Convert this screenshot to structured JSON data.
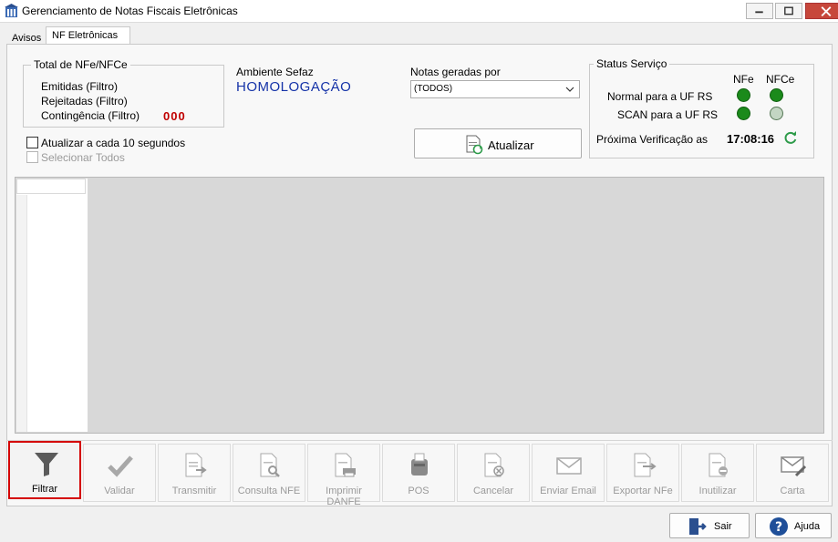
{
  "window": {
    "title": "Gerenciamento de Notas Fiscais Eletrônicas",
    "icon": "building-icon",
    "controls": [
      "minimize-icon",
      "maximize-icon",
      "close-icon"
    ]
  },
  "tabs": [
    {
      "label": "Avisos",
      "active": false
    },
    {
      "label": "NF Eletrônicas",
      "active": true
    }
  ],
  "totals": {
    "title": "Total de NFe/NFCe",
    "emitidas": "Emitidas (Filtro)",
    "rejeitadas": "Rejeitadas (Filtro)",
    "contingencia": "Contingência (Filtro)",
    "contingencia_value": "000"
  },
  "ambiente": {
    "label": "Ambiente Sefaz",
    "value": "HOMOLOGAÇÃO"
  },
  "notas": {
    "label": "Notas geradas por",
    "selected": "(TODOS)"
  },
  "options": {
    "auto_refresh": "Atualizar a cada 10 segundos",
    "select_all": "Selecionar Todos"
  },
  "atualizar_button": "Atualizar",
  "status": {
    "title": "Status Serviço",
    "col_nfe": "NFe",
    "col_nfce": "NFCe",
    "rows": [
      {
        "label": "Normal para a UF RS",
        "nfe": "online",
        "nfce": "online"
      },
      {
        "label": "SCAN para a UF RS",
        "nfe": "online",
        "nfce": "offline"
      }
    ],
    "next_check_label": "Próxima Verificação as",
    "next_check_time": "17:08:16",
    "colors": {
      "online": "#1b8a1b",
      "offline": "#c3d6c3"
    }
  },
  "toolbar": [
    {
      "label": "Filtrar",
      "icon": "filter-icon",
      "enabled": true
    },
    {
      "label": "Validar",
      "icon": "checkmark-icon",
      "enabled": false
    },
    {
      "label": "Transmitir",
      "icon": "document-send-icon",
      "enabled": false
    },
    {
      "label": "Consulta NFE",
      "icon": "document-search-icon",
      "enabled": false
    },
    {
      "label": "Imprimir DANFE",
      "icon": "document-print-icon",
      "enabled": false
    },
    {
      "label": "POS",
      "icon": "pos-printer-icon",
      "enabled": false
    },
    {
      "label": "Cancelar",
      "icon": "document-cancel-icon",
      "enabled": false
    },
    {
      "label": "Enviar Email",
      "icon": "envelope-icon",
      "enabled": false
    },
    {
      "label": "Exportar NFe",
      "icon": "document-export-icon",
      "enabled": false
    },
    {
      "label": "Inutilizar",
      "icon": "document-void-icon",
      "enabled": false
    },
    {
      "label": "Carta",
      "icon": "letter-pen-icon",
      "enabled": false
    }
  ],
  "footer": {
    "sair": "Sair",
    "ajuda": "Ajuda"
  },
  "accent": "#d40000"
}
